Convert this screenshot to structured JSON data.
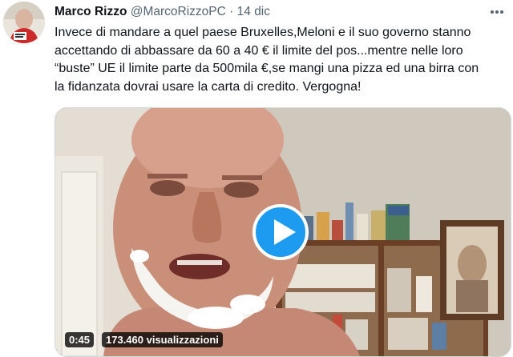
{
  "tweet": {
    "author_name": "Marco Rizzo",
    "handle": "@MarcoRizzoPC",
    "separator": "·",
    "date": "14 dic",
    "more_icon": "more-dots-icon",
    "text_lines": [
      "Invece di mandare a quel paese Bruxelles,Meloni e il suo governo stanno",
      "accettando di abbassare da 60 a 40 € il limite del pos...mentre nelle loro",
      "“buste” UE il limite parte da 500mila €,se mangi una pizza ed una birra con",
      "la fidanzata dovrai usare la carta di credito. Vergogna!"
    ]
  },
  "video": {
    "duration": "0:45",
    "views": "173.460 visualizzazioni",
    "play_icon": "play-icon",
    "accent_color": "#1d9bf0"
  }
}
